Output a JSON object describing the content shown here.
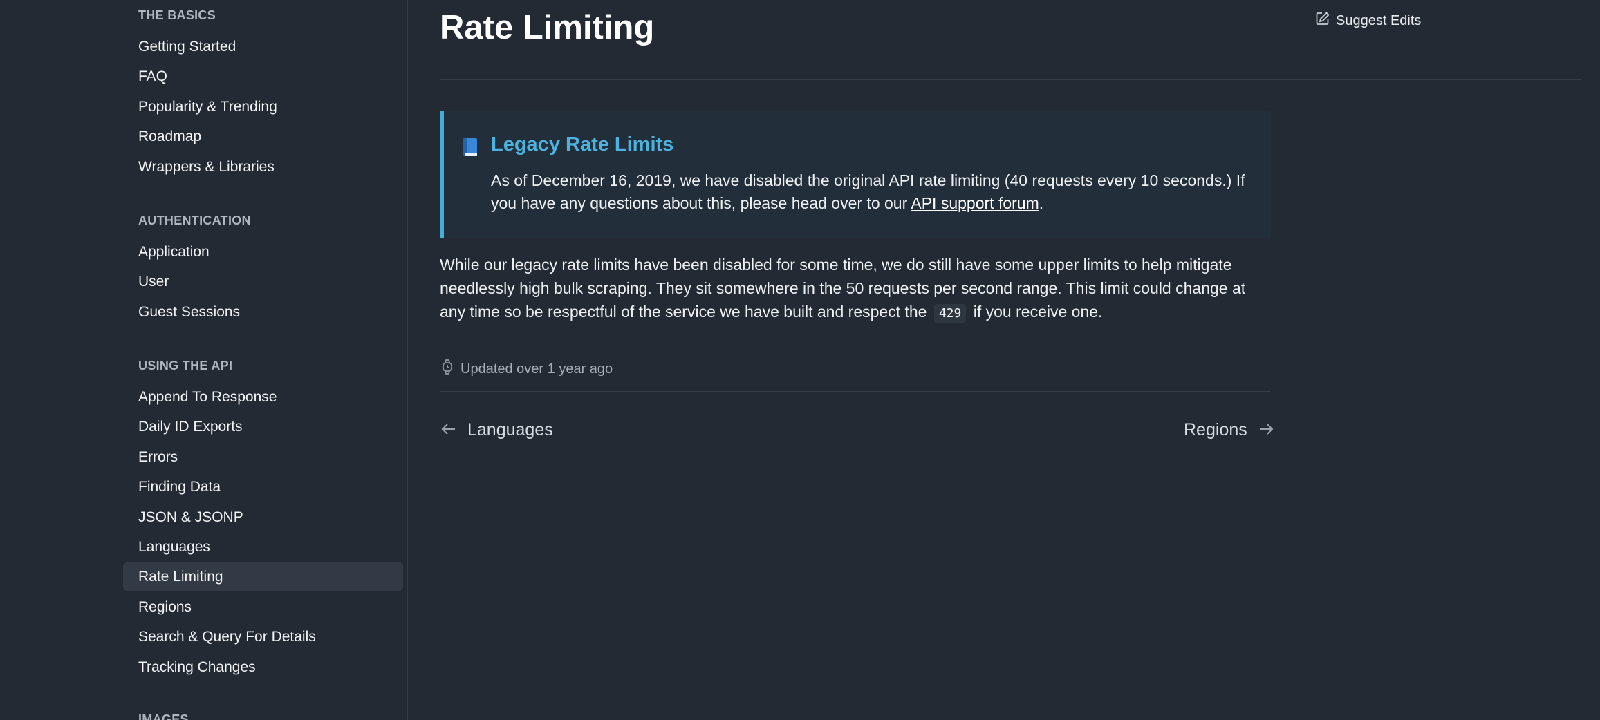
{
  "sidebar": {
    "sections": [
      {
        "heading": "THE BASICS",
        "items": [
          {
            "label": "Getting Started"
          },
          {
            "label": "FAQ"
          },
          {
            "label": "Popularity & Trending"
          },
          {
            "label": "Roadmap"
          },
          {
            "label": "Wrappers & Libraries"
          }
        ]
      },
      {
        "heading": "AUTHENTICATION",
        "items": [
          {
            "label": "Application"
          },
          {
            "label": "User"
          },
          {
            "label": "Guest Sessions"
          }
        ]
      },
      {
        "heading": "USING THE API",
        "items": [
          {
            "label": "Append To Response"
          },
          {
            "label": "Daily ID Exports"
          },
          {
            "label": "Errors"
          },
          {
            "label": "Finding Data"
          },
          {
            "label": "JSON & JSONP"
          },
          {
            "label": "Languages"
          },
          {
            "label": "Rate Limiting",
            "active": true
          },
          {
            "label": "Regions"
          },
          {
            "label": "Search & Query For Details"
          },
          {
            "label": "Tracking Changes"
          }
        ]
      },
      {
        "heading": "IMAGES",
        "items": []
      }
    ]
  },
  "page": {
    "title": "Rate Limiting",
    "suggest_edits": "Suggest Edits",
    "callout": {
      "icon": "blue-book-icon",
      "title": "Legacy Rate Limits",
      "body_before": "As of December 16, 2019, we have disabled the original API rate limiting (40 requests every 10 seconds.) If you have any questions about this, please head over to our ",
      "link": "API support forum",
      "body_after": "."
    },
    "paragraph_before": "While our legacy rate limits have been disabled for some time, we do still have some upper limits to help mitigate needlessly high bulk scraping. They sit somewhere in the 50 requests per second range. This limit could change at any time so be respectful of the service we have built and respect the ",
    "code": "429",
    "paragraph_after": " if you receive one.",
    "updated": "Updated over 1 year ago",
    "prev_label": "Languages",
    "next_label": "Regions"
  },
  "colors": {
    "background": "#242a33",
    "accent": "#3fb0d6",
    "callout_title": "#4cb3df"
  }
}
